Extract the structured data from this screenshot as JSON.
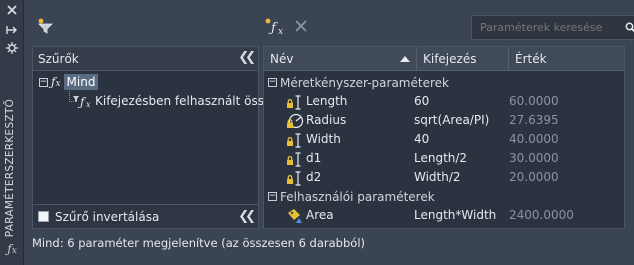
{
  "palette": {
    "vertical_title": "PARAMÉTERSZERKESZTŐ",
    "icons": [
      "close-icon",
      "auto-hide-icon",
      "properties-icon",
      "fx-icon"
    ]
  },
  "toolbar": {
    "icons": [
      "filter-icon",
      "new-user-parameter-icon",
      "delete-icon"
    ],
    "search_placeholder": "Paraméterek keresése"
  },
  "filters_panel": {
    "title": "Szűrők",
    "tree": [
      {
        "label": "Mind",
        "selected": true
      },
      {
        "label": "Kifejezésben felhasznált összes"
      }
    ],
    "invert_label": "Szűrő invertálása",
    "invert_checked": false
  },
  "grid": {
    "columns": [
      "Név",
      "Kifejezés",
      "Érték"
    ],
    "groups": [
      {
        "title": "Méretkényszer-paraméterek",
        "rows": [
          {
            "name": "Length",
            "expression": "60",
            "value": "60.0000",
            "icon": "linear-dimension-lock-icon"
          },
          {
            "name": "Radius",
            "expression": "sqrt(Area/PI)",
            "value": "27.6395",
            "icon": "radial-dimension-lock-icon"
          },
          {
            "name": "Width",
            "expression": "40",
            "value": "40.0000",
            "icon": "linear-dimension-lock-icon"
          },
          {
            "name": "d1",
            "expression": "Length/2",
            "value": "30.0000",
            "icon": "linear-dimension-lock-icon"
          },
          {
            "name": "d2",
            "expression": "Width/2",
            "value": "20.0000",
            "icon": "linear-dimension-lock-icon"
          }
        ]
      },
      {
        "title": "Felhasználói paraméterek",
        "rows": [
          {
            "name": "Area",
            "expression": "Length*Width",
            "value": "2400.0000",
            "icon": "user-parameter-icon"
          }
        ]
      }
    ]
  },
  "status": "Mind: 6 paraméter megjelenítve (az összesen 6 darabból)",
  "colors": {
    "background": "#3b4453",
    "panel": "#2c3340",
    "selection": "#5a6b84",
    "lock": "#e8c037",
    "muted_value": "#8a93a1"
  }
}
